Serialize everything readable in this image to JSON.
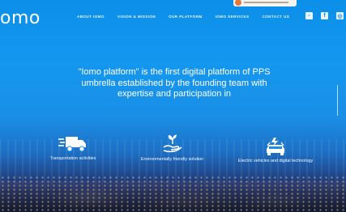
{
  "header": {
    "logo": "omo",
    "nav": [
      "ABOUT IOMO",
      "VISION & MISSION",
      "OUR PLATFORM",
      "IOMO SERVICES",
      "CONTACT US"
    ],
    "social_icons": [
      "square-icon",
      "facebook-icon",
      "instagram-icon"
    ]
  },
  "hero": {
    "headline": "\"Iomo platform\" is the first digital platform of PPS umbrella established by the founding team with expertise and participation in"
  },
  "features": [
    {
      "icon": "delivery-truck-icon",
      "label": "Transportation activities"
    },
    {
      "icon": "hand-plant-icon",
      "label": "Environmentally friendly solution"
    },
    {
      "icon": "electric-car-icon",
      "label": "Electric vehicles and digital technology"
    }
  ],
  "colors": {
    "accent": "#1497ef",
    "text": "#ffffff"
  }
}
